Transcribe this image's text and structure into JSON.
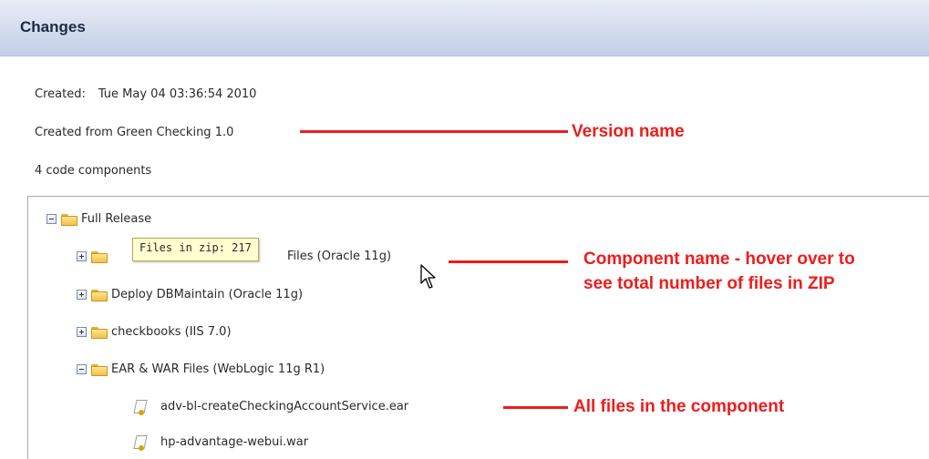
{
  "panel": {
    "title": "Changes"
  },
  "meta": {
    "created_label": "Created:",
    "created_value": "Tue May 04 03:36:54 2010",
    "created_from": "Created from Green Checking 1.0",
    "components_count": "4 code components"
  },
  "tree": {
    "root": {
      "label": "Full Release",
      "expanded": true
    },
    "components": [
      {
        "label": "Files (Oracle 11g)",
        "expanded": false,
        "hovered": true
      },
      {
        "label": "Deploy DBMaintain (Oracle 11g)",
        "expanded": false
      },
      {
        "label": "checkbooks (IIS 7.0)",
        "expanded": false
      },
      {
        "label": "EAR & WAR Files (WebLogic 11g R1)",
        "expanded": true,
        "files": [
          {
            "label": "adv-bl-createCheckingAccountService.ear"
          },
          {
            "label": "hp-advantage-webui.war"
          }
        ]
      }
    ]
  },
  "tooltip": {
    "text": "Files in zip: 217"
  },
  "annotations": {
    "version": "Version name",
    "component_line1": "Component name - hover over to",
    "component_line2": "see total number of files in ZIP",
    "files": "All files in the component",
    "color": "#ee1c1c"
  },
  "icons": {
    "expand": "plus-box-icon",
    "collapse": "minus-box-icon",
    "folder": "folder-icon",
    "file": "file-icon",
    "cursor": "mouse-pointer-icon"
  }
}
